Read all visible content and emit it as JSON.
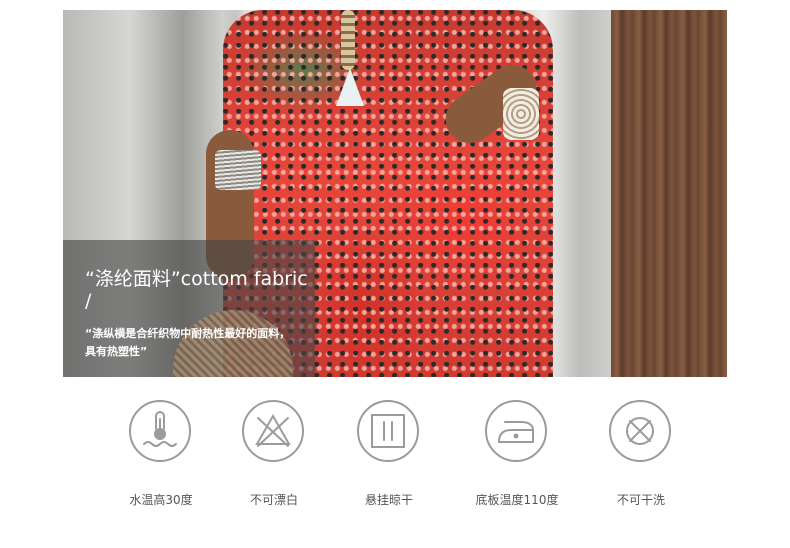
{
  "hero": {
    "title": "“涤纶面料”cottom fabric\n/",
    "description": "“涤纵横是合纤织物中耐热性最好的面料，\n具有热塑性”"
  },
  "care_items": [
    {
      "icon": "water-temperature-icon",
      "label": "水温高30度"
    },
    {
      "icon": "no-bleach-icon",
      "label": "不可漂白"
    },
    {
      "icon": "hang-dry-icon",
      "label": "悬挂晾干"
    },
    {
      "icon": "iron-temperature-icon",
      "label": "底板温度110度"
    },
    {
      "icon": "no-tumble-dry-icon",
      "label": "不可干洗"
    }
  ],
  "colors": {
    "icon_stroke": "#9b9b9b",
    "label_text": "#555555",
    "overlay": "#464646"
  }
}
